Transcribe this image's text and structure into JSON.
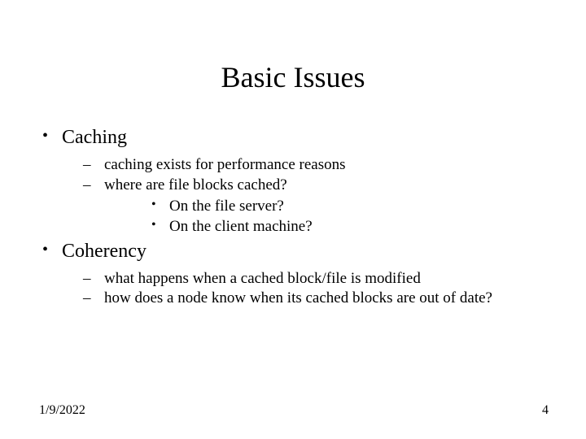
{
  "title": "Basic Issues",
  "bullets": {
    "b1": {
      "label": "Caching",
      "sub": {
        "s1": "caching exists for performance reasons",
        "s2": "where are file blocks cached?",
        "s2sub": {
          "t1": "On the file server?",
          "t2": "On the client machine?"
        }
      }
    },
    "b2": {
      "label": "Coherency",
      "sub": {
        "s1": "what happens when a cached block/file is modified",
        "s2": "how does a node know when its cached blocks are out of date?"
      }
    }
  },
  "footer": {
    "date": "1/9/2022",
    "page": "4"
  }
}
